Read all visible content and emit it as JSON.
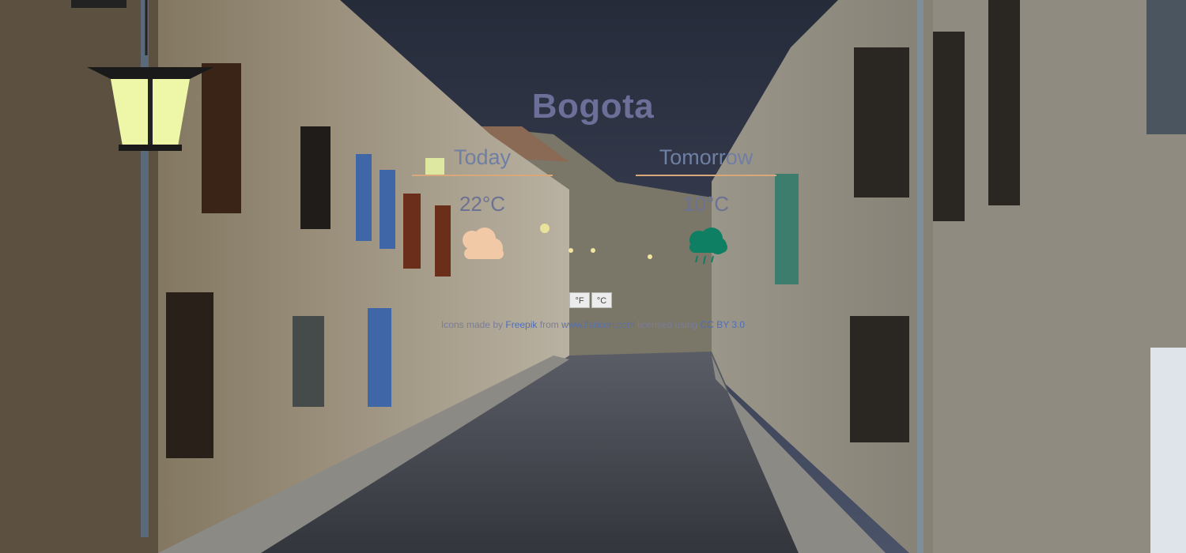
{
  "weather": {
    "city": "Bogota",
    "today": {
      "label": "Today",
      "temp": "22°C",
      "icon": "partly-cloudy-icon"
    },
    "tomorrow": {
      "label": "Tomorrow",
      "temp": "10°C",
      "icon": "rain-cloud-icon"
    },
    "unit_buttons": {
      "fahrenheit": "°F",
      "celsius": "°C"
    }
  },
  "credits": {
    "prefix": "Icons made by",
    "author": "Freepik",
    "middle": "from",
    "site": "www.flaticon.com",
    "license_prefix": "licensed using",
    "license": "CC BY 3.0"
  },
  "colors": {
    "today_icon": "#f1c9a7",
    "tomorrow_icon": "#0f7f63",
    "underline": "#d8a87a",
    "city_text": "#6c6f98",
    "link": "#4e6fb8"
  }
}
